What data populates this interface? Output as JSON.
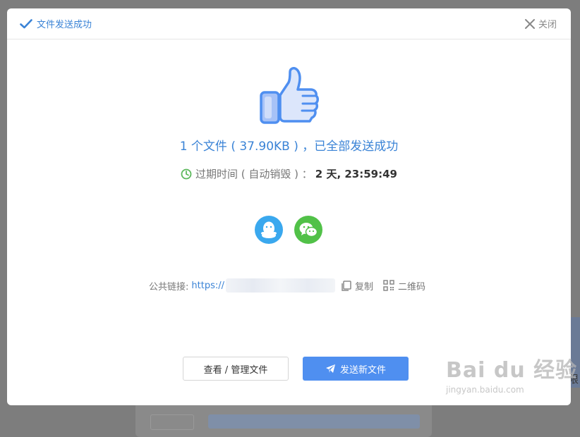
{
  "header": {
    "title": "文件发送成功",
    "close_label": "关闭"
  },
  "icons": {
    "success": "check-icon",
    "close": "close-x-icon",
    "thumb": "thumbs-up-icon",
    "clock": "clock-icon",
    "qq": "qq-icon",
    "wechat": "wechat-icon",
    "copy": "copy-icon",
    "qrcode": "qrcode-icon",
    "send": "paper-plane-icon"
  },
  "colors": {
    "accent": "#3a83d6",
    "primary_button": "#4f8ff0",
    "qq": "#3aa8ee",
    "wechat": "#51c148",
    "clock": "#5cb85c"
  },
  "result": {
    "summary": "1 个文件 ( 37.90KB ) ，已全部发送成功",
    "expire_label": "过期时间 ( 自动销毁 ) ：",
    "expire_value": "2 天, 23:59:49"
  },
  "link": {
    "label": "公共链接:",
    "url_prefix": "https://",
    "copy_label": "复制",
    "qrcode_label": "二维码"
  },
  "buttons": {
    "manage_label": "查看 / 管理文件",
    "send_new_label": "发送新文件"
  },
  "watermark": {
    "brand": "Bai du 经验",
    "url": "jingyan.baidu.com"
  }
}
